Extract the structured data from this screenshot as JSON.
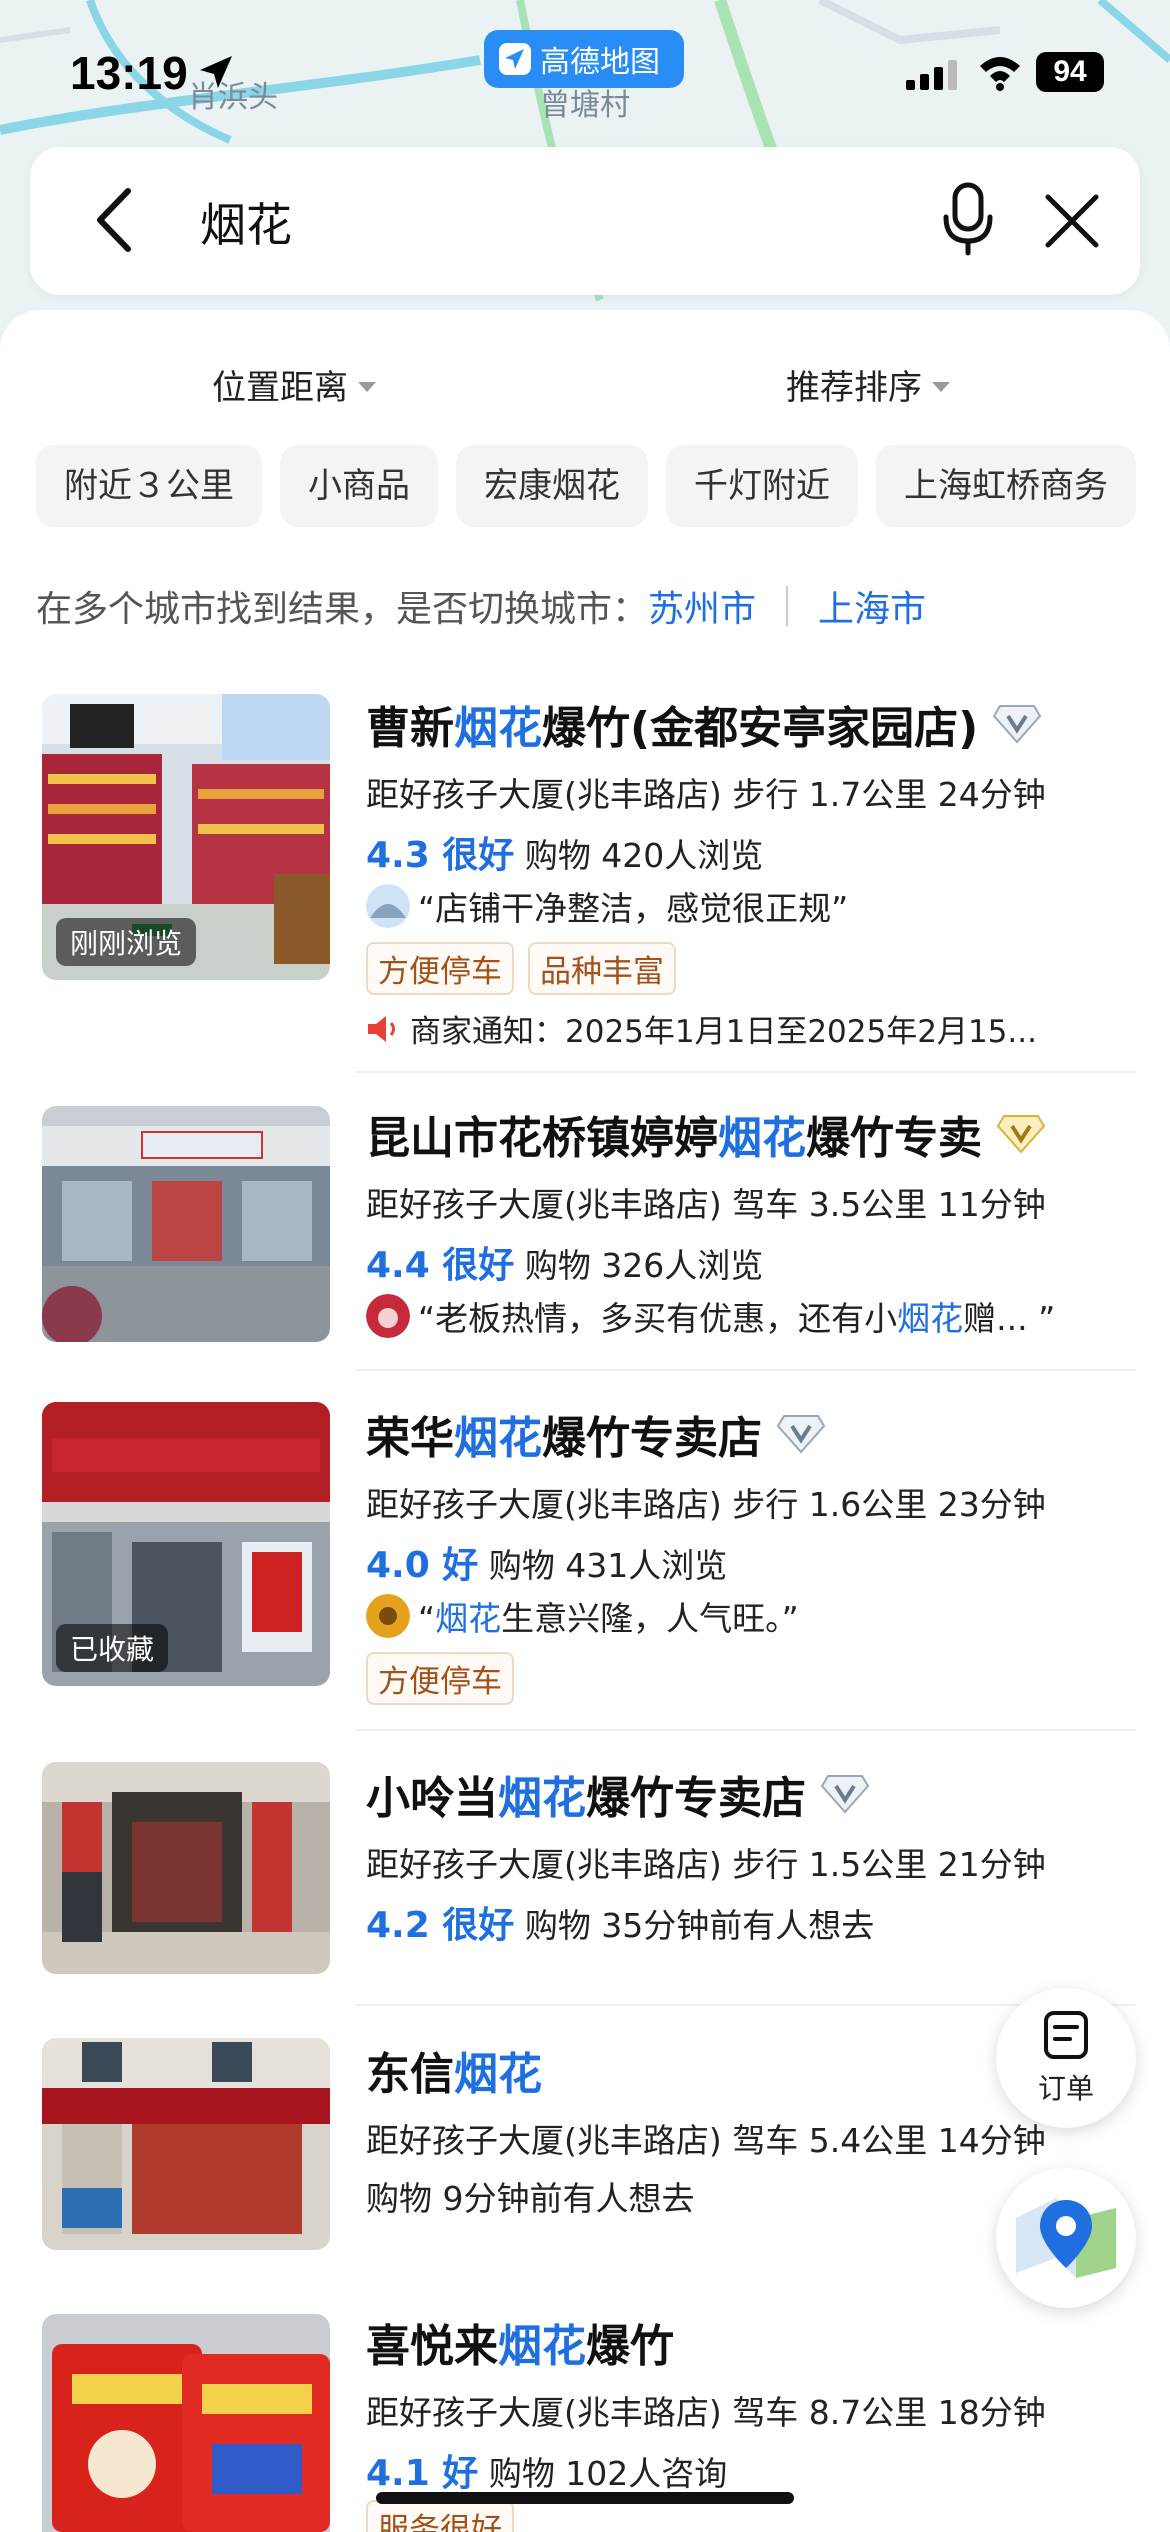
{
  "status_bar": {
    "time": "13:19",
    "app_badge": "高德地图",
    "battery": "94"
  },
  "map": {
    "labels": [
      "肖浜头",
      "曾塘村"
    ]
  },
  "search": {
    "query": "烟花"
  },
  "sort": {
    "distance": "位置距离",
    "order": "推荐排序"
  },
  "chips": [
    "附近３公里",
    "小商品",
    "宏康烟花",
    "千灯附近",
    "上海虹桥商务"
  ],
  "city_switch": {
    "prompt": "在多个城市找到结果，是否切换城市：",
    "cities": [
      "苏州市",
      "上海市"
    ]
  },
  "results": [
    {
      "title_pre": "曹新",
      "title_hl": "烟花",
      "title_post": "爆竹(金都安亭家园店)",
      "distance": "距好孩子大厦(兆丰路店) 步行 1.7公里  24分钟",
      "rating": "4.3 很好",
      "meta": "购物  420人浏览",
      "review_pre": "“店铺干净整洁，感觉很正规”",
      "review_hl": "",
      "review_post": "",
      "tags": [
        "方便停车",
        "品种丰富"
      ],
      "notice": "商家通知：2025年1月1日至2025年2月15...",
      "thumb_tag": "刚刚浏览",
      "badge_color": "#9aa7b5"
    },
    {
      "title_pre": "昆山市花桥镇婷婷",
      "title_hl": "烟花",
      "title_post": "爆竹专卖",
      "distance": "距好孩子大厦(兆丰路店) 驾车 3.5公里  11分钟",
      "rating": "4.4 很好",
      "meta": "购物  326人浏览",
      "review_pre": "“老板热情，多买有优惠，还有小",
      "review_hl": "烟花",
      "review_post": "赠...   ”",
      "tags": [],
      "notice": "",
      "thumb_tag": "",
      "badge_color": "#d8b23a"
    },
    {
      "title_pre": "荣华",
      "title_hl": "烟花",
      "title_post": "爆竹专卖店",
      "distance": "距好孩子大厦(兆丰路店) 步行 1.6公里  23分钟",
      "rating": "4.0 好",
      "meta": "购物  431人浏览",
      "review_pre": "“",
      "review_hl": "烟花",
      "review_post": "生意兴隆，人气旺。”",
      "tags": [
        "方便停车"
      ],
      "notice": "",
      "thumb_tag": "已收藏",
      "badge_color": "#9aa7b5"
    },
    {
      "title_pre": "小呤当",
      "title_hl": "烟花",
      "title_post": "爆竹专卖店",
      "distance": "距好孩子大厦(兆丰路店) 步行 1.5公里  21分钟",
      "rating": "4.2 很好",
      "meta": "购物  35分钟前有人想去",
      "review_pre": "",
      "review_hl": "",
      "review_post": "",
      "tags": [],
      "notice": "",
      "thumb_tag": "",
      "badge_color": "#9aa7b5"
    },
    {
      "title_pre": "东信",
      "title_hl": "烟花",
      "title_post": "",
      "distance": "距好孩子大厦(兆丰路店) 驾车 5.4公里  14分钟",
      "rating": "",
      "meta": "购物  9分钟前有人想去",
      "review_pre": "",
      "review_hl": "",
      "review_post": "",
      "tags": [],
      "notice": "",
      "thumb_tag": "",
      "badge_color": ""
    },
    {
      "title_pre": "喜悦来",
      "title_hl": "烟花",
      "title_post": "爆竹",
      "distance": "距好孩子大厦(兆丰路店) 驾车 8.7公里  18分钟",
      "rating": "4.1 好",
      "meta": "购物  102人咨询",
      "review_pre": "",
      "review_hl": "",
      "review_post": "",
      "tags": [
        "服务很好"
      ],
      "notice": "",
      "thumb_tag": "",
      "badge_color": ""
    }
  ],
  "fab": {
    "order_label": "订单"
  },
  "colors": {
    "highlight": "#1f6fe0",
    "tag_text": "#a0521a",
    "amap_blue": "#2a8cf5"
  }
}
